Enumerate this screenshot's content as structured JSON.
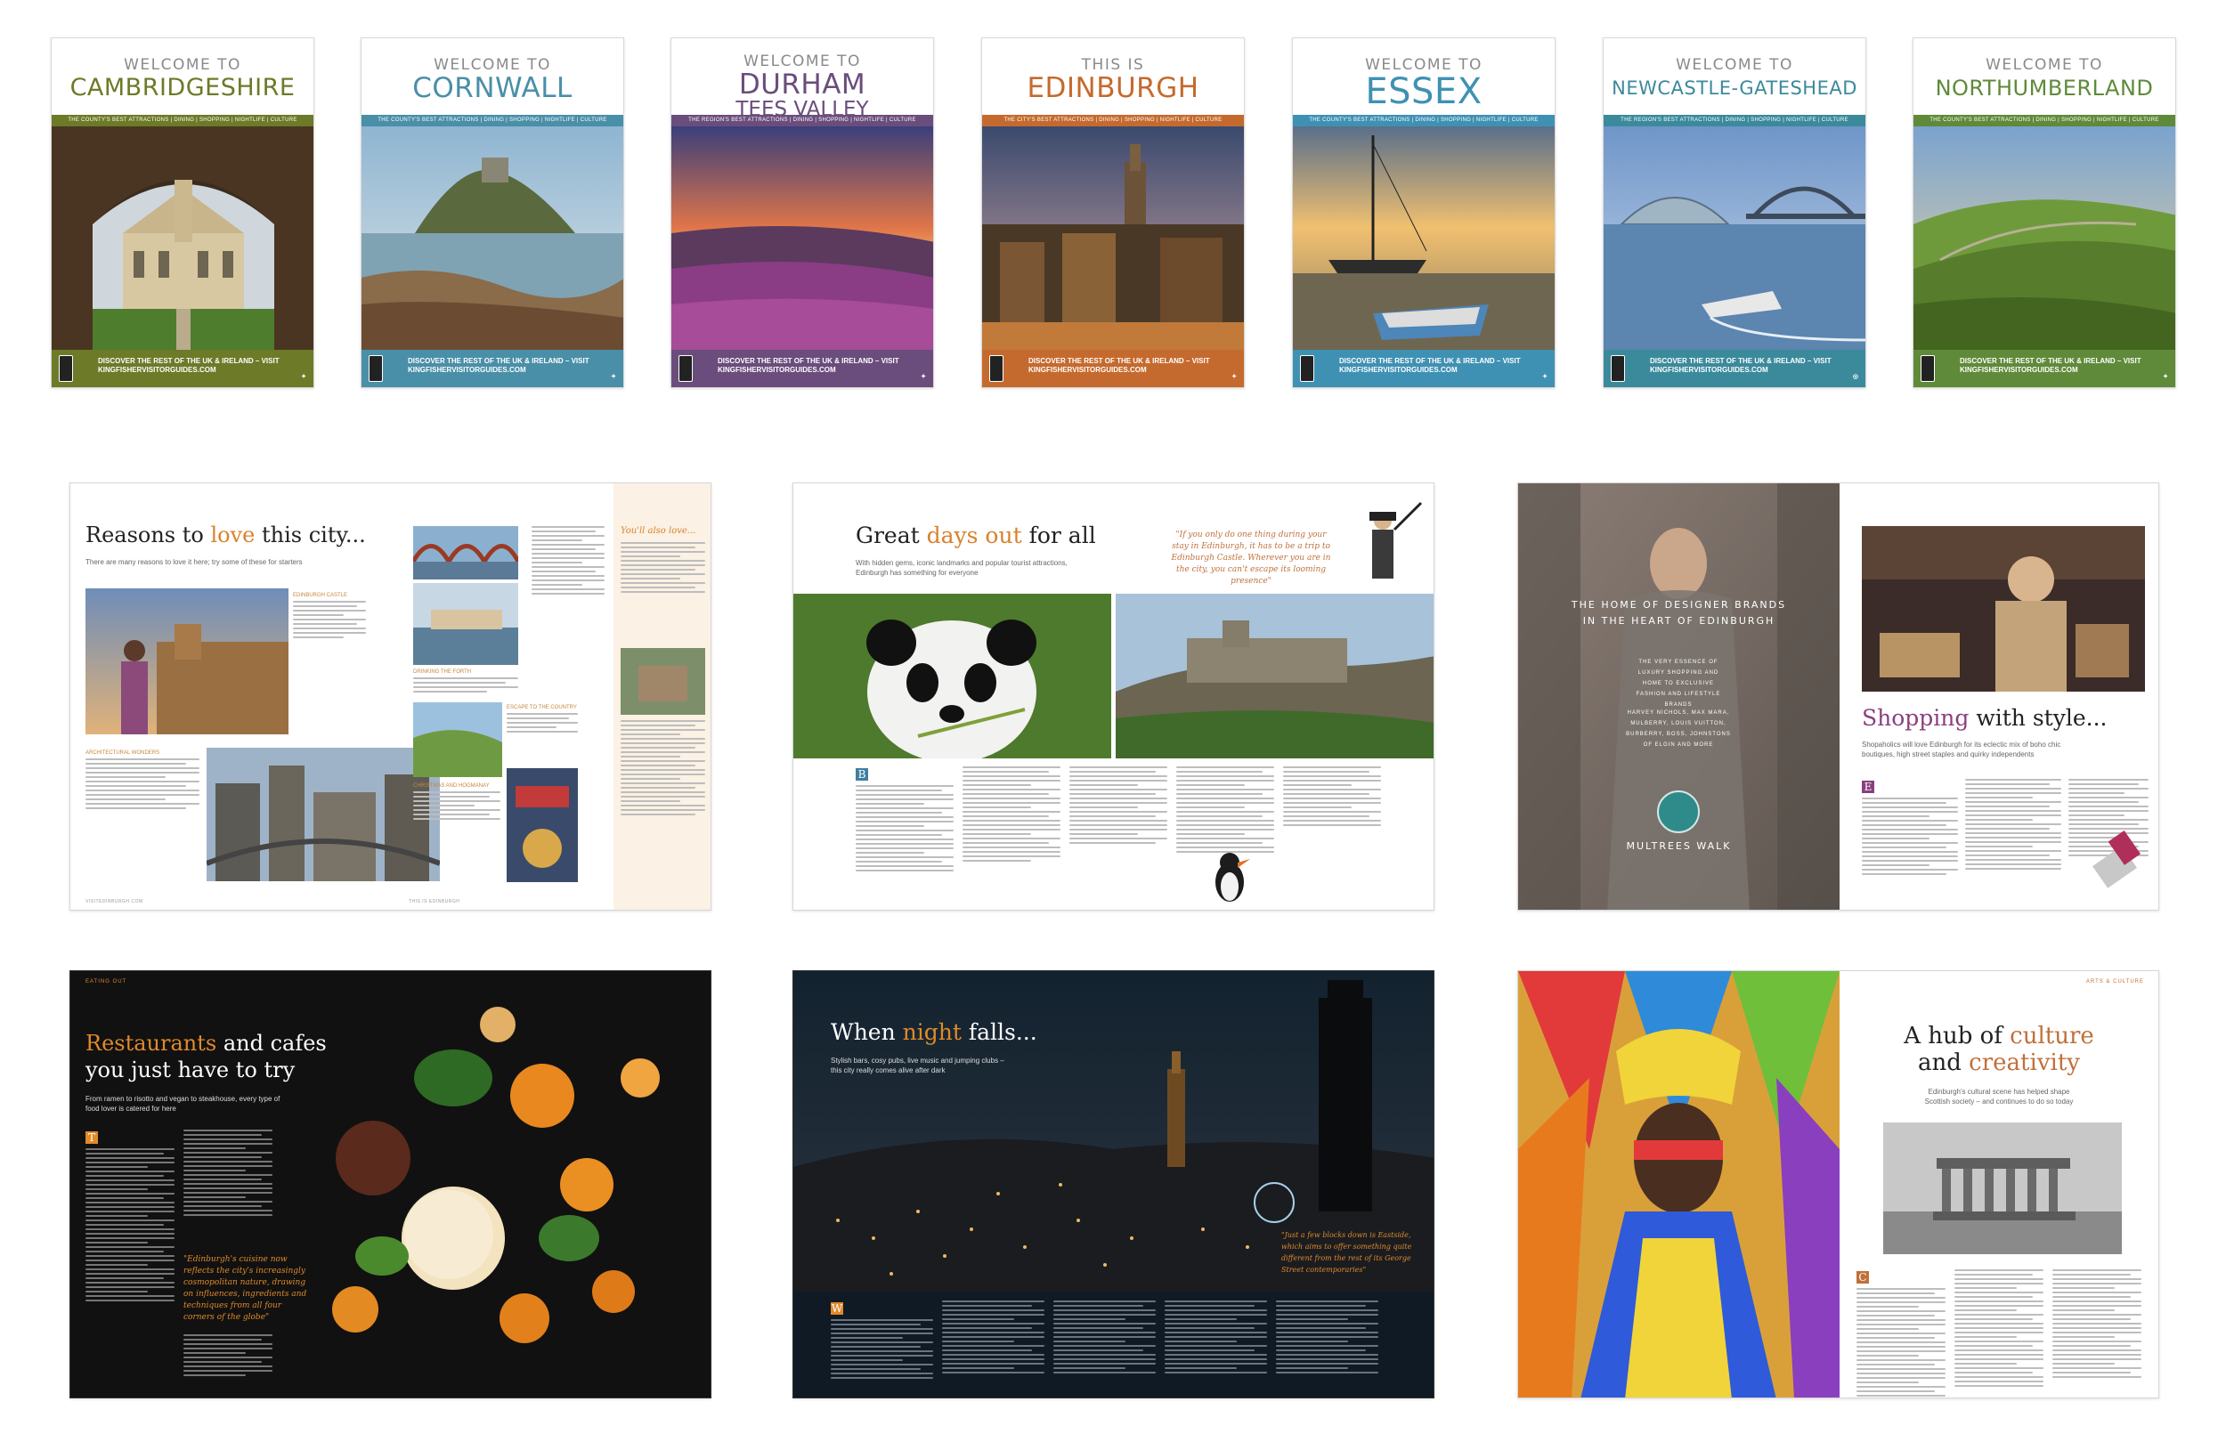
{
  "covers": [
    {
      "welcome": "WELCOME TO",
      "name": "CAMBRIDGESHIRE",
      "name2": "",
      "accent": "#6d7a28",
      "strip": "THE COUNTY'S BEST ATTRACTIONS | DINING | SHOPPING | NIGHTLIFE | CULTURE",
      "footer": "DISCOVER THE REST OF THE UK & IRELAND – VISIT KINGFISHERVISITORGUIDES.COM"
    },
    {
      "welcome": "WELCOME TO",
      "name": "CORNWALL",
      "name2": "",
      "accent": "#4a8fa8",
      "strip": "THE COUNTY'S BEST ATTRACTIONS | DINING | SHOPPING | NIGHTLIFE | CULTURE",
      "footer": "DISCOVER THE REST OF THE UK & IRELAND – VISIT KINGFISHERVISITORGUIDES.COM"
    },
    {
      "welcome": "WELCOME TO",
      "name": "DURHAM",
      "name2": "TEES VALLEY",
      "accent": "#6a4d7c",
      "strip": "THE REGION'S BEST ATTRACTIONS | DINING | SHOPPING | NIGHTLIFE | CULTURE",
      "footer": "DISCOVER THE REST OF THE UK & IRELAND – VISIT KINGFISHERVISITORGUIDES.COM"
    },
    {
      "welcome": "THIS IS",
      "name": "EDINBURGH",
      "name2": "",
      "accent": "#c56a2e",
      "strip": "THE CITY'S BEST ATTRACTIONS | DINING | SHOPPING | NIGHTLIFE | CULTURE",
      "footer": "DISCOVER THE REST OF THE UK & IRELAND – VISIT KINGFISHERVISITORGUIDES.COM"
    },
    {
      "welcome": "WELCOME TO",
      "name": "ESSEX",
      "name2": "",
      "accent": "#3f91b3",
      "strip": "THE COUNTY'S BEST ATTRACTIONS | DINING | SHOPPING | NIGHTLIFE | CULTURE",
      "footer": "DISCOVER THE REST OF THE UK & IRELAND – VISIT KINGFISHERVISITORGUIDES.COM"
    },
    {
      "welcome": "WELCOME TO",
      "name": "NEWCASTLE-GATESHEAD",
      "name2": "",
      "accent": "#3b8a9c",
      "strip": "THE REGION'S BEST ATTRACTIONS | DINING | SHOPPING | NIGHTLIFE | CULTURE",
      "footer": "DISCOVER THE REST OF THE UK & IRELAND – VISIT KINGFISHERVISITORGUIDES.COM"
    },
    {
      "welcome": "WELCOME TO",
      "name": "NORTHUMBERLAND",
      "name2": "",
      "accent": "#5f8a3a",
      "strip": "THE COUNTY'S BEST ATTRACTIONS | DINING | SHOPPING | NIGHTLIFE | CULTURE",
      "footer": "DISCOVER THE REST OF THE UK & IRELAND – VISIT KINGFISHERVISITORGUIDES.COM"
    }
  ],
  "spreads": {
    "reasons": {
      "title_a": "Reasons to ",
      "title_b": "love",
      "title_c": " this city...",
      "stand": "There are many reasons to love it here; try some of these for starters",
      "side_head": "You'll also love...",
      "cap1": "EDINBURGH CASTLE",
      "cap2": "ARCHITECTURAL WONDERS",
      "cap3": "DRINKING THE FORTH",
      "cap4": "ESCAPE TO THE COUNTRY",
      "cap5": "CHRISTMAS AND HOGMANAY",
      "footer_l": "VISITEDINBURGH.COM",
      "footer_r": "THIS IS EDINBURGH"
    },
    "daysout": {
      "title_a": "Great ",
      "title_b": "days out",
      "title_c": " for all",
      "stand": "With hidden gems, iconic landmarks and popular tourist attractions, Edinburgh has something for everyone",
      "quote": "\"If you only do one thing during your stay in Edinburgh, it has to be a trip to Edinburgh Castle. Wherever you are in the city, you can't escape its looming presence\"",
      "dropcap": "B"
    },
    "shopping": {
      "ad_line1": "THE HOME OF DESIGNER BRANDS",
      "ad_line2": "IN THE HEART OF EDINBURGH",
      "ad_body": "THE VERY ESSENCE OF LUXURY SHOPPING AND HOME TO EXCLUSIVE FASHION AND LIFESTYLE BRANDS",
      "ad_brands": "HARVEY NICHOLS, MAX MARA, MULBERRY, LOUIS VUITTON, BURBERRY, BOSS, JOHNSTONS OF ELGIN AND MORE",
      "ad_logo": "MULTREES WALK",
      "title_a": "Shopping",
      "title_b": " with style...",
      "stand": "Shopaholics will love Edinburgh for its eclectic mix of boho chic boutiques, high street staples and quirky independents"
    },
    "restaurants": {
      "title_a": "Restaurants",
      "title_b": " and cafes",
      "title_c": "you just have to try",
      "stand": "From ramen to risotto and vegan to steakhouse, every type of food lover is catered for here",
      "quote": "\"Edinburgh's cuisine now reflects the city's increasingly cosmopolitan nature, drawing on influences, ingredients and techniques from all four corners of the globe\"",
      "dropcap": "T"
    },
    "night": {
      "title_a": "When ",
      "title_b": "night",
      "title_c": " falls...",
      "stand": "Stylish bars, cosy pubs, live music and jumping clubs – this city really comes alive after dark",
      "quote": "\"Just a few blocks down is Eastside, which aims to offer something quite different from the rest of its George Street contemporaries\"",
      "dropcap": "W"
    },
    "culture": {
      "title_a": "A hub of ",
      "title_b": "culture",
      "title_c": "and ",
      "title_d": "creativity",
      "stand": "Edinburgh's cultural scene has helped shape Scottish society – and continues to do so today",
      "dropcap": "C"
    }
  },
  "colors": {
    "love_orange": "#d9822b",
    "days_orange": "#d9822b",
    "shopping_purple": "#8a3f7e",
    "restaurant_orange": "#e08a2a",
    "culture_orange": "#c0703a"
  }
}
